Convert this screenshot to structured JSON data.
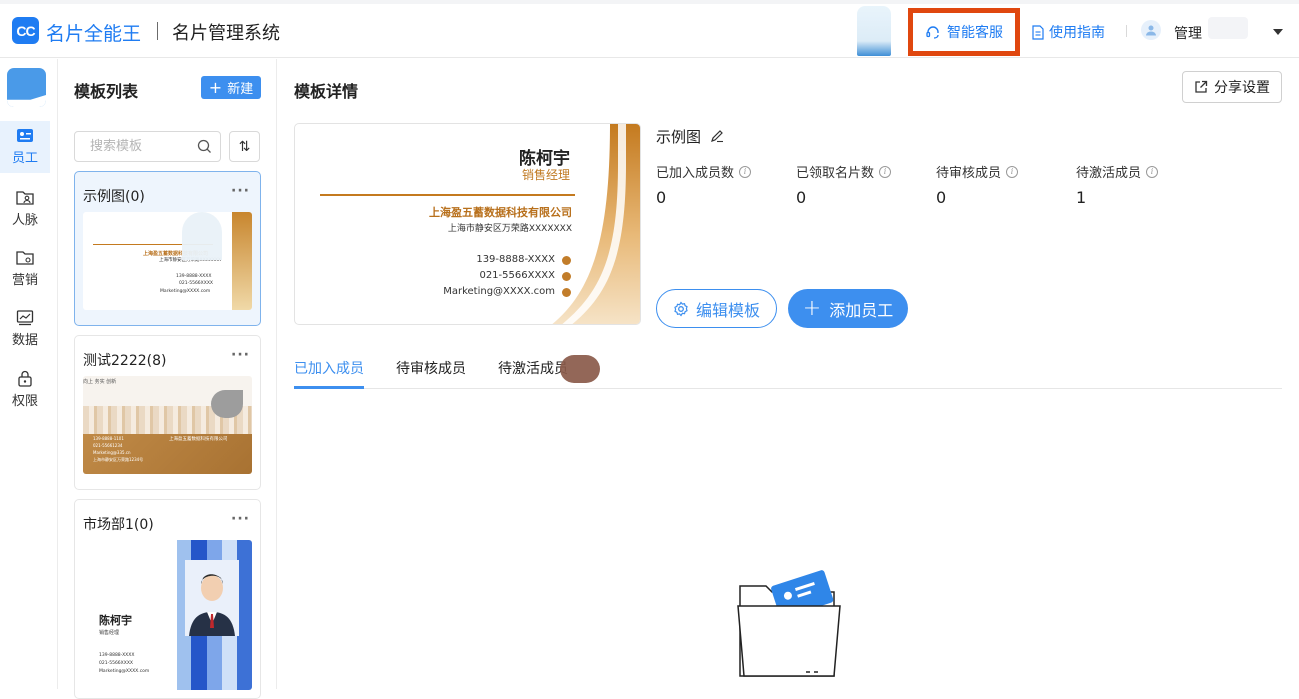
{
  "brand": {
    "logo_badge": "CC",
    "logo_text": "名片全能王",
    "system_title": "名片管理系统",
    "accent": "#1f7cf2"
  },
  "header": {
    "support_label": "智能客服",
    "guide_label": "使用指南",
    "admin_label": "管理"
  },
  "nav": [
    {
      "label": "员工",
      "icon": "id-card-icon",
      "active": true
    },
    {
      "label": "人脉",
      "icon": "contacts-folder-icon"
    },
    {
      "label": "营销",
      "icon": "marketing-folder-icon"
    },
    {
      "label": "数据",
      "icon": "chart-icon"
    },
    {
      "label": "权限",
      "icon": "lock-icon"
    }
  ],
  "list": {
    "title": "模板列表",
    "new_label": "新建",
    "search_placeholder": "搜索模板",
    "sort_label": "⇅",
    "cards": [
      {
        "name": "示例图(0)",
        "selected": true,
        "thumb": {
          "company": "上海盈五蓄数据科技有限公司",
          "addr": "上海市静安区万荣路XXXXXXX",
          "phone": "139-8888-XXXX",
          "tel": "021-5566XXXX",
          "email": "Marketing@XXXX.com"
        }
      },
      {
        "name": "测试2222(8)",
        "thumb": {
          "slogan": "向上 务实 创新",
          "company": "上海盈五蓄数据科技有限公司",
          "phone": "139-8888-1101",
          "tel": "021-55661234",
          "email": "Marketing@335.cn",
          "addr": "上海市静安区万荣路1234号"
        }
      },
      {
        "name": "市场部1(0)",
        "thumb": {
          "person": "陈柯宇",
          "role": "销售经理",
          "phone": "139-8888-XXXX",
          "tel": "021-5566XXXX",
          "email": "Marketing@XXXX.com"
        }
      }
    ]
  },
  "detail": {
    "title": "模板详情",
    "share_label": "分享设置",
    "card": {
      "name": "陈柯宇",
      "role": "销售经理",
      "company": "上海盈五蓄数据科技有限公司",
      "address": "上海市静安区万荣路XXXXXXX",
      "phone": "139-8888-XXXX",
      "tel": "021-5566XXXX",
      "email": "Marketing@XXXX.com"
    },
    "template_name": "示例图",
    "stats": [
      {
        "label": "已加入成员数",
        "value": "0"
      },
      {
        "label": "已领取名片数",
        "value": "0"
      },
      {
        "label": "待审核成员",
        "value": "0"
      },
      {
        "label": "待激活成员",
        "value": "1"
      }
    ],
    "edit_label": "编辑模板",
    "add_label": "添加员工",
    "tabs": [
      {
        "label": "已加入成员",
        "active": true
      },
      {
        "label": "待审核成员"
      },
      {
        "label": "待激活成员"
      }
    ]
  }
}
